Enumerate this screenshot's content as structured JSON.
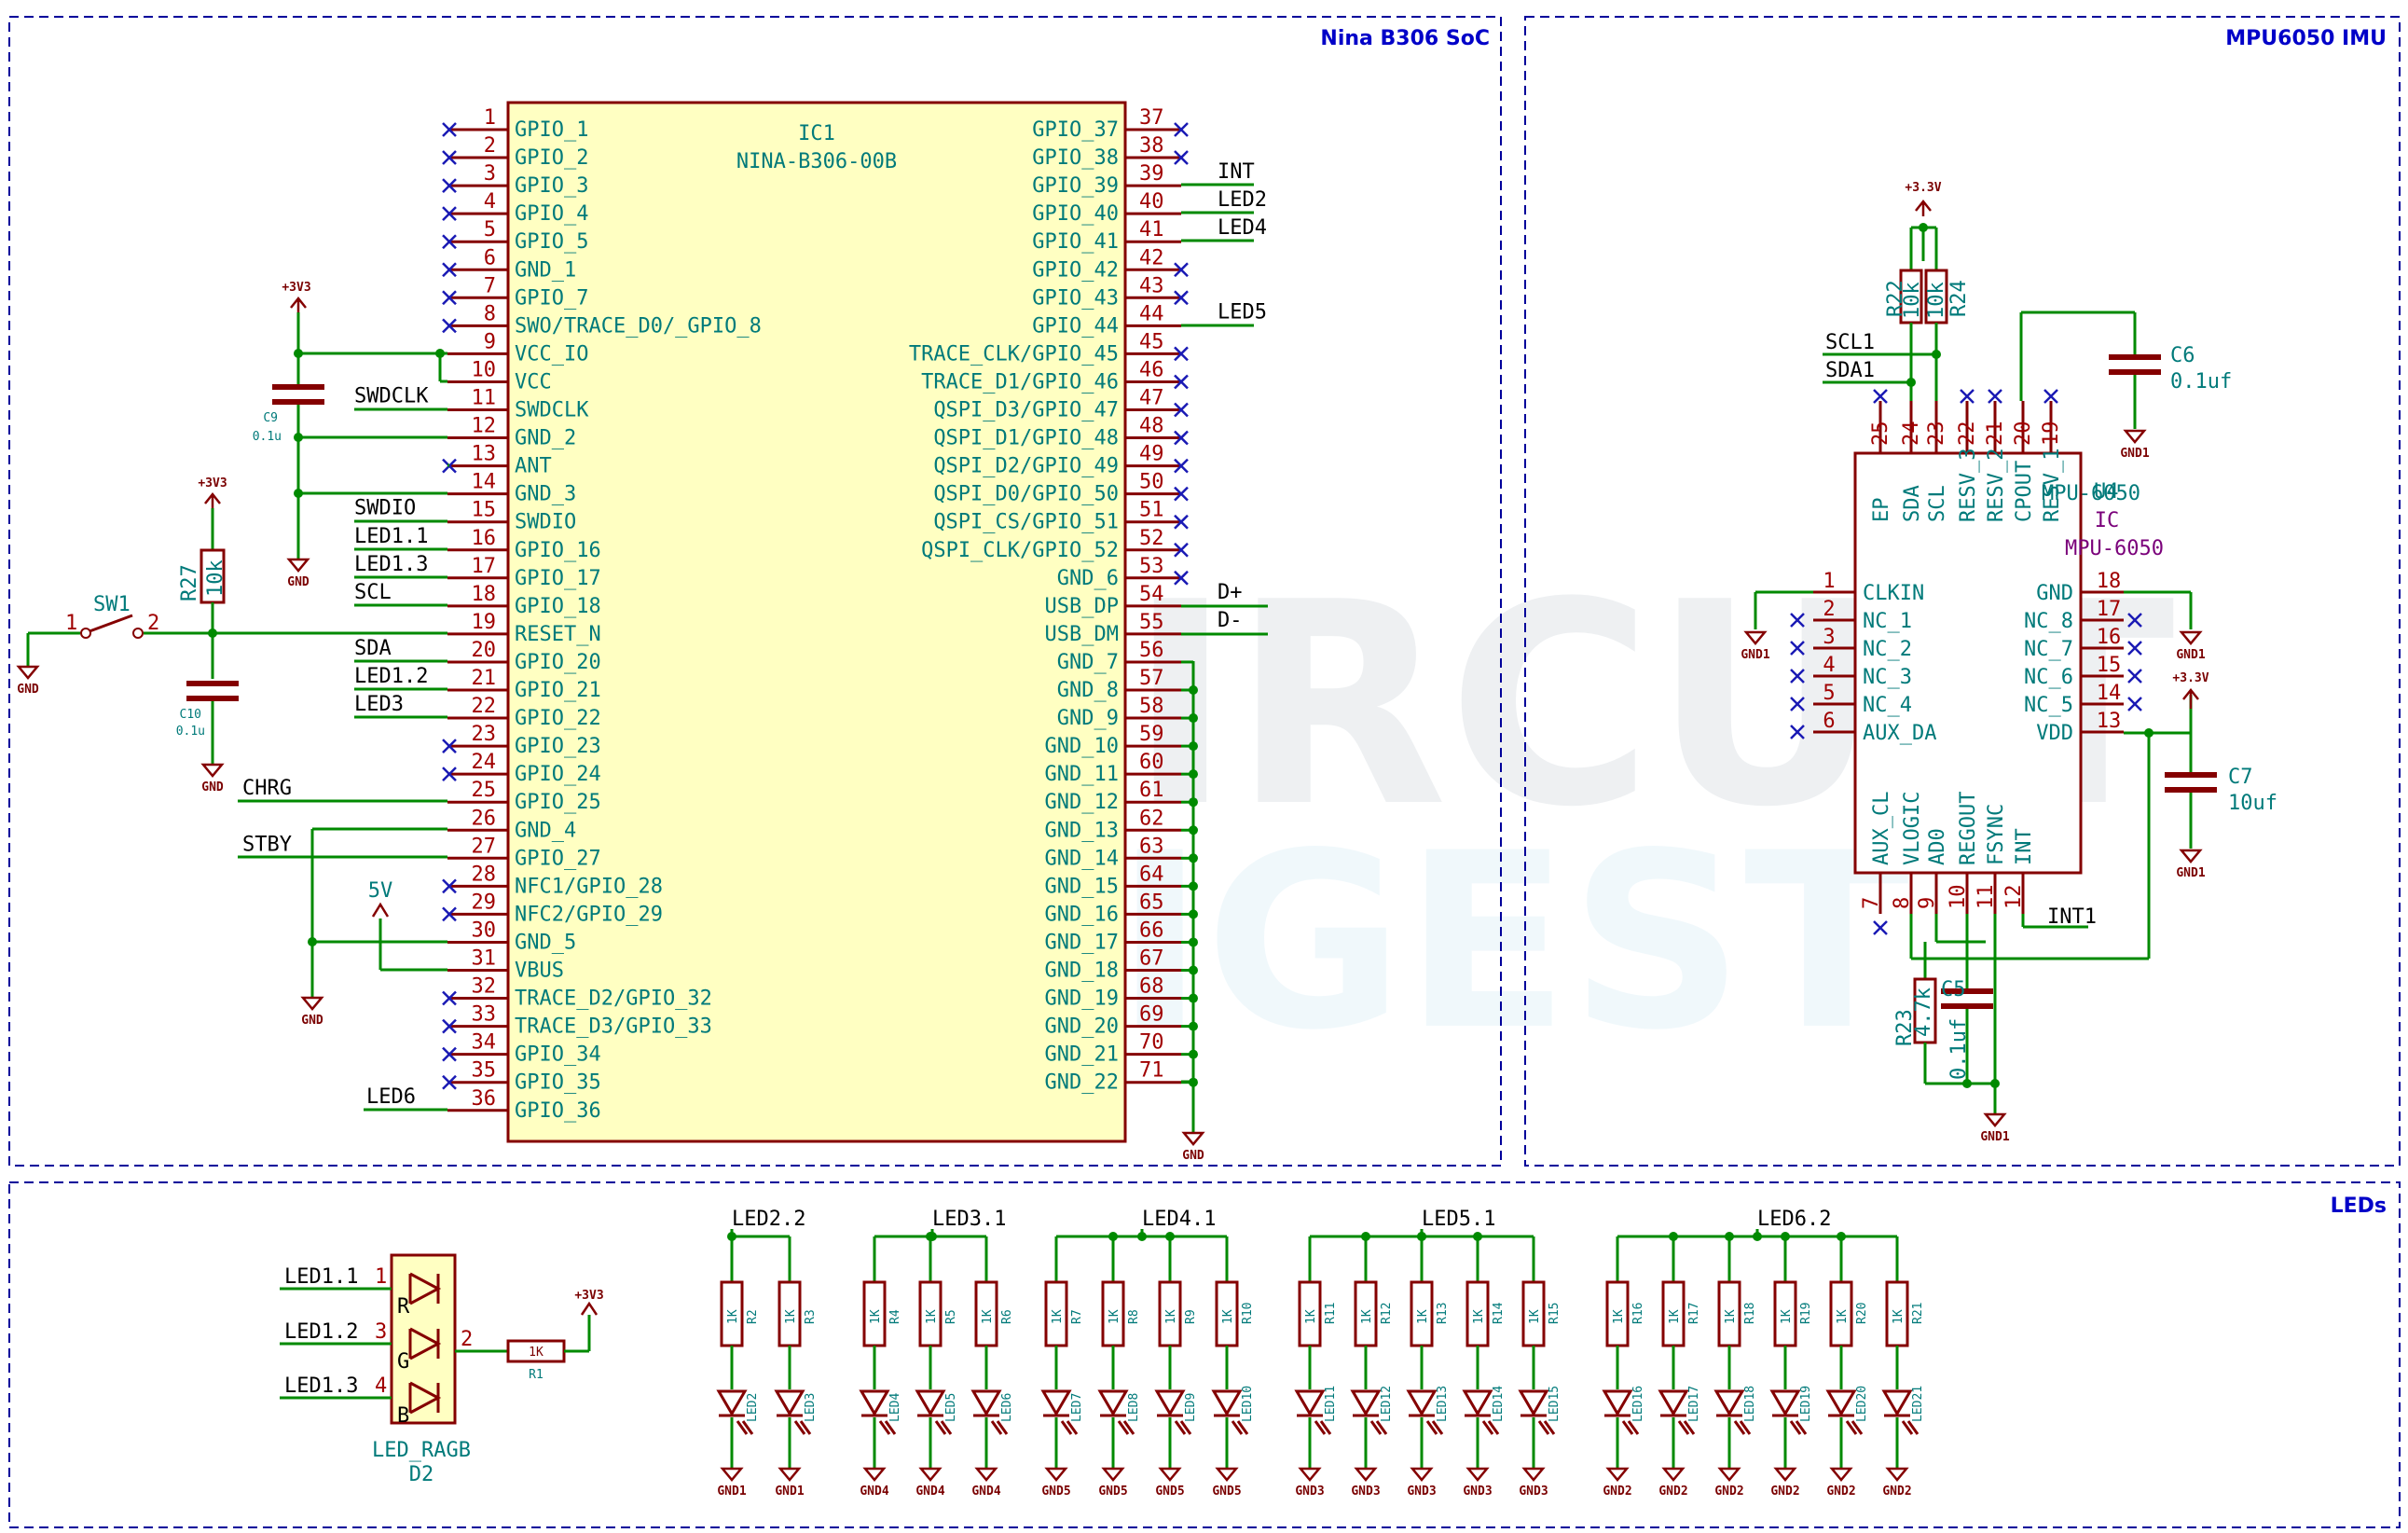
{
  "frames": {
    "soc_title": "Nina B306 SoC",
    "imu_title": "MPU6050 IMU",
    "leds_title": "LEDs"
  },
  "watermark": {
    "line1": "CIRCUIT",
    "line2": "DIGEST"
  },
  "ic1": {
    "ref": "IC1",
    "value": "NINA-B306-00B",
    "left_pins": [
      {
        "num": "1",
        "name": "GPIO_1",
        "net": ""
      },
      {
        "num": "2",
        "name": "GPIO_2",
        "net": ""
      },
      {
        "num": "3",
        "name": "GPIO_3",
        "net": ""
      },
      {
        "num": "4",
        "name": "GPIO_4",
        "net": ""
      },
      {
        "num": "5",
        "name": "GPIO_5",
        "net": ""
      },
      {
        "num": "6",
        "name": "GND_1",
        "net": ""
      },
      {
        "num": "7",
        "name": "GPIO_7",
        "net": ""
      },
      {
        "num": "8",
        "name": "SWO/TRACE_D0/_GPIO_8",
        "net": ""
      },
      {
        "num": "9",
        "name": "VCC_IO",
        "net": ""
      },
      {
        "num": "10",
        "name": "VCC",
        "net": ""
      },
      {
        "num": "11",
        "name": "SWDCLK",
        "net": "SWDCLK"
      },
      {
        "num": "12",
        "name": "GND_2",
        "net": ""
      },
      {
        "num": "13",
        "name": "ANT",
        "net": ""
      },
      {
        "num": "14",
        "name": "GND_3",
        "net": ""
      },
      {
        "num": "15",
        "name": "SWDIO",
        "net": "SWDIO"
      },
      {
        "num": "16",
        "name": "GPIO_16",
        "net": "LED1.1"
      },
      {
        "num": "17",
        "name": "GPIO_17",
        "net": "LED1.3"
      },
      {
        "num": "18",
        "name": "GPIO_18",
        "net": "SCL"
      },
      {
        "num": "19",
        "name": "RESET_N",
        "net": ""
      },
      {
        "num": "20",
        "name": "GPIO_20",
        "net": "SDA"
      },
      {
        "num": "21",
        "name": "GPIO_21",
        "net": "LED1.2"
      },
      {
        "num": "22",
        "name": "GPIO_22",
        "net": "LED3"
      },
      {
        "num": "23",
        "name": "GPIO_23",
        "net": ""
      },
      {
        "num": "24",
        "name": "GPIO_24",
        "net": ""
      },
      {
        "num": "25",
        "name": "GPIO_25",
        "net": "CHRG"
      },
      {
        "num": "26",
        "name": "GND_4",
        "net": ""
      },
      {
        "num": "27",
        "name": "GPIO_27",
        "net": "STBY"
      },
      {
        "num": "28",
        "name": "NFC1/GPIO_28",
        "net": ""
      },
      {
        "num": "29",
        "name": "NFC2/GPIO_29",
        "net": ""
      },
      {
        "num": "30",
        "name": "GND_5",
        "net": ""
      },
      {
        "num": "31",
        "name": "VBUS",
        "net": ""
      },
      {
        "num": "32",
        "name": "TRACE_D2/GPIO_32",
        "net": ""
      },
      {
        "num": "33",
        "name": "TRACE_D3/GPIO_33",
        "net": ""
      },
      {
        "num": "34",
        "name": "GPIO_34",
        "net": ""
      },
      {
        "num": "35",
        "name": "GPIO_35",
        "net": ""
      },
      {
        "num": "36",
        "name": "GPIO_36",
        "net": "LED6"
      }
    ],
    "right_pins": [
      {
        "num": "37",
        "name": "GPIO_37",
        "net": ""
      },
      {
        "num": "38",
        "name": "GPIO_38",
        "net": ""
      },
      {
        "num": "39",
        "name": "GPIO_39",
        "net": "INT"
      },
      {
        "num": "40",
        "name": "GPIO_40",
        "net": "LED2"
      },
      {
        "num": "41",
        "name": "GPIO_41",
        "net": "LED4"
      },
      {
        "num": "42",
        "name": "GPIO_42",
        "net": ""
      },
      {
        "num": "43",
        "name": "GPIO_43",
        "net": ""
      },
      {
        "num": "44",
        "name": "GPIO_44",
        "net": "LED5"
      },
      {
        "num": "45",
        "name": "TRACE_CLK/GPIO_45",
        "net": ""
      },
      {
        "num": "46",
        "name": "TRACE_D1/GPIO_46",
        "net": ""
      },
      {
        "num": "47",
        "name": "QSPI_D3/GPIO_47",
        "net": ""
      },
      {
        "num": "48",
        "name": "QSPI_D1/GPIO_48",
        "net": ""
      },
      {
        "num": "49",
        "name": "QSPI_D2/GPIO_49",
        "net": ""
      },
      {
        "num": "50",
        "name": "QSPI_D0/GPIO_50",
        "net": ""
      },
      {
        "num": "51",
        "name": "QSPI_CS/GPIO_51",
        "net": ""
      },
      {
        "num": "52",
        "name": "QSPI_CLK/GPIO_52",
        "net": ""
      },
      {
        "num": "53",
        "name": "GND_6",
        "net": ""
      },
      {
        "num": "54",
        "name": "USB_DP",
        "net": "D+"
      },
      {
        "num": "55",
        "name": "USB_DM",
        "net": "D-"
      },
      {
        "num": "56",
        "name": "GND_7",
        "net": ""
      },
      {
        "num": "57",
        "name": "GND_8",
        "net": ""
      },
      {
        "num": "58",
        "name": "GND_9",
        "net": ""
      },
      {
        "num": "59",
        "name": "GND_10",
        "net": ""
      },
      {
        "num": "60",
        "name": "GND_11",
        "net": ""
      },
      {
        "num": "61",
        "name": "GND_12",
        "net": ""
      },
      {
        "num": "62",
        "name": "GND_13",
        "net": ""
      },
      {
        "num": "63",
        "name": "GND_14",
        "net": ""
      },
      {
        "num": "64",
        "name": "GND_15",
        "net": ""
      },
      {
        "num": "65",
        "name": "GND_16",
        "net": ""
      },
      {
        "num": "66",
        "name": "GND_17",
        "net": ""
      },
      {
        "num": "67",
        "name": "GND_18",
        "net": ""
      },
      {
        "num": "68",
        "name": "GND_19",
        "net": ""
      },
      {
        "num": "69",
        "name": "GND_20",
        "net": ""
      },
      {
        "num": "70",
        "name": "GND_21",
        "net": ""
      },
      {
        "num": "71",
        "name": "GND_22",
        "net": ""
      }
    ]
  },
  "soc_parts": {
    "c9_ref": "C9",
    "c9_val": "0.1u",
    "c10_ref": "C10",
    "c10_val": "0.1u",
    "r27_ref": "R27",
    "r27_val": "10k",
    "sw1_ref": "SW1",
    "sw1_p1": "1",
    "sw1_p2": "2",
    "pwr_3v3": "+3V3",
    "gnd": "GND",
    "vbus": "5V"
  },
  "u4": {
    "ref": "U4",
    "value": "MPU-6050",
    "ic_label": "IC",
    "value2": "MPU-6050",
    "top_pins": [
      {
        "num": "25",
        "name": "EP"
      },
      {
        "num": "24",
        "name": "SDA"
      },
      {
        "num": "23",
        "name": "SCL"
      },
      {
        "num": "22",
        "name": "RESV_3"
      },
      {
        "num": "21",
        "name": "RESV_2"
      },
      {
        "num": "20",
        "name": "CPOUT"
      },
      {
        "num": "19",
        "name": "RESV_1"
      }
    ],
    "left_pins": [
      {
        "num": "1",
        "name": "CLKIN"
      },
      {
        "num": "2",
        "name": "NC_1"
      },
      {
        "num": "3",
        "name": "NC_2"
      },
      {
        "num": "4",
        "name": "NC_3"
      },
      {
        "num": "5",
        "name": "NC_4"
      },
      {
        "num": "6",
        "name": "AUX_DA"
      }
    ],
    "right_pins": [
      {
        "num": "18",
        "name": "GND"
      },
      {
        "num": "17",
        "name": "NC_8"
      },
      {
        "num": "16",
        "name": "NC_7"
      },
      {
        "num": "15",
        "name": "NC_6"
      },
      {
        "num": "14",
        "name": "NC_5"
      },
      {
        "num": "13",
        "name": "VDD"
      }
    ],
    "bottom_pins": [
      {
        "num": "7",
        "name": "AUX_CL"
      },
      {
        "num": "8",
        "name": "VLOGIC"
      },
      {
        "num": "9",
        "name": "AD0"
      },
      {
        "num": "10",
        "name": "REGOUT"
      },
      {
        "num": "11",
        "name": "FSYNC"
      },
      {
        "num": "12",
        "name": "INT"
      }
    ]
  },
  "imu_parts": {
    "r22_ref": "R22",
    "r22_val": "10k",
    "r24_ref": "R24",
    "r24_val": "10k",
    "r23_ref": "R23",
    "r23_val": "4.7k",
    "c6_ref": "C6",
    "c6_val": "0.1uf",
    "c5_ref": "C5",
    "c5_val": "0.1uf",
    "c7_ref": "C7",
    "c7_val": "10uf",
    "scl": "SCL1",
    "sda": "SDA1",
    "int": "INT1",
    "pwr_33": "+3.3V",
    "gnd1": "GND1"
  },
  "rgb": {
    "ref": "D2",
    "value": "LED_RAGB",
    "n1": "LED1.1",
    "n2": "LED1.2",
    "n3": "LED1.3",
    "p1": "1",
    "p2": "3",
    "p3": "4",
    "p4": "2",
    "r": "R",
    "g": "G",
    "b": "B",
    "r1_ref": "R1",
    "r1_val": "1K",
    "pwr": "+3V3"
  },
  "led_groups": [
    {
      "net": "LED2.2",
      "leds": [
        {
          "r": "R2",
          "d": "LED2",
          "g": "GND1"
        },
        {
          "r": "R3",
          "d": "LED3",
          "g": "GND1"
        }
      ]
    },
    {
      "net": "LED3.1",
      "leds": [
        {
          "r": "R4",
          "d": "LED4",
          "g": "GND4"
        },
        {
          "r": "R5",
          "d": "LED5",
          "g": "GND4"
        },
        {
          "r": "R6",
          "d": "LED6",
          "g": "GND4"
        }
      ]
    },
    {
      "net": "LED4.1",
      "leds": [
        {
          "r": "R7",
          "d": "LED7",
          "g": "GND5"
        },
        {
          "r": "R8",
          "d": "LED8",
          "g": "GND5"
        },
        {
          "r": "R9",
          "d": "LED9",
          "g": "GND5"
        },
        {
          "r": "R10",
          "d": "LED10",
          "g": "GND5"
        }
      ]
    },
    {
      "net": "LED5.1",
      "leds": [
        {
          "r": "R11",
          "d": "LED11",
          "g": "GND3"
        },
        {
          "r": "R12",
          "d": "LED12",
          "g": "GND3"
        },
        {
          "r": "R13",
          "d": "LED13",
          "g": "GND3"
        },
        {
          "r": "R14",
          "d": "LED14",
          "g": "GND3"
        },
        {
          "r": "R15",
          "d": "LED15",
          "g": "GND3"
        }
      ]
    },
    {
      "net": "LED6.2",
      "leds": [
        {
          "r": "R16",
          "d": "LED16",
          "g": "GND2"
        },
        {
          "r": "R17",
          "d": "LED17",
          "g": "GND2"
        },
        {
          "r": "R18",
          "d": "LED18",
          "g": "GND2"
        },
        {
          "r": "R19",
          "d": "LED19",
          "g": "GND2"
        },
        {
          "r": "R20",
          "d": "LED20",
          "g": "GND2"
        },
        {
          "r": "R21",
          "d": "LED21",
          "g": "GND2"
        }
      ]
    }
  ],
  "led_res_val": "1K"
}
